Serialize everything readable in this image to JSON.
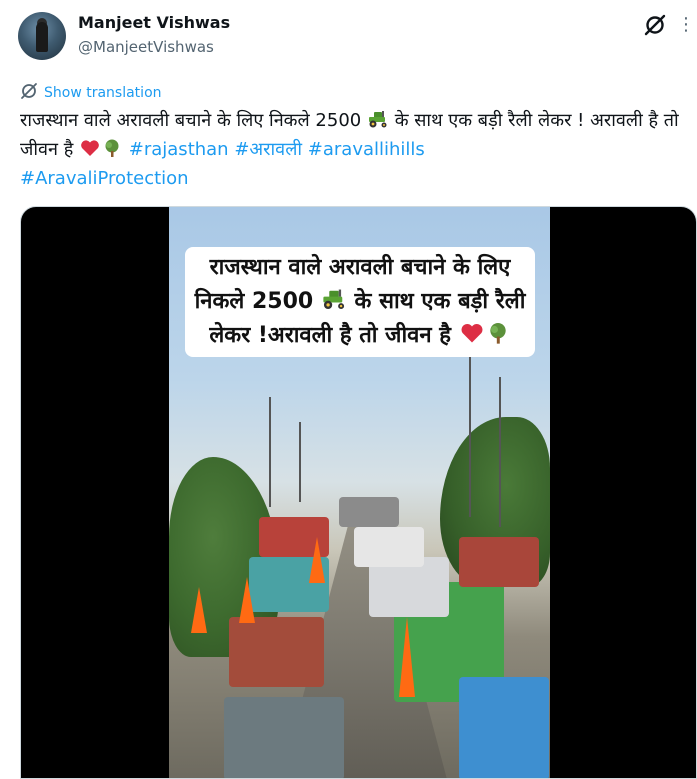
{
  "author": {
    "display_name": "Manjeet Vishwas",
    "handle": "@ManjeetVishwas"
  },
  "header": {
    "grok_icon": "grok-icon",
    "more_icon": "more-icon",
    "more_glyph": "⋮"
  },
  "translate": {
    "label": "Show translation",
    "icon": "globe-icon"
  },
  "tweet": {
    "text_part1": "राजस्थान वाले अरावली बचाने के लिए निकले 2500 ",
    "text_part2": " के साथ एक बड़ी रैली लेकर !",
    "text_part3": "अरावली है तो जीवन है ",
    "hashtags": [
      "#rajasthan",
      "#अरावली",
      "#aravallihills",
      "#AravaliProtection"
    ]
  },
  "media": {
    "caption_part1": "राजस्थान वाले अरावली बचाने के लिए निकले 2500 ",
    "caption_part2": " के साथ एक बड़ी रैली लेकर !अरावली है तो जीवन है ",
    "icons": [
      "tractor-emoji",
      "heart-emoji",
      "tree-emoji"
    ]
  },
  "colors": {
    "link": "#1d9bf0",
    "text": "#0f1419",
    "secondary": "#536471",
    "flag": "#ff6a13"
  }
}
